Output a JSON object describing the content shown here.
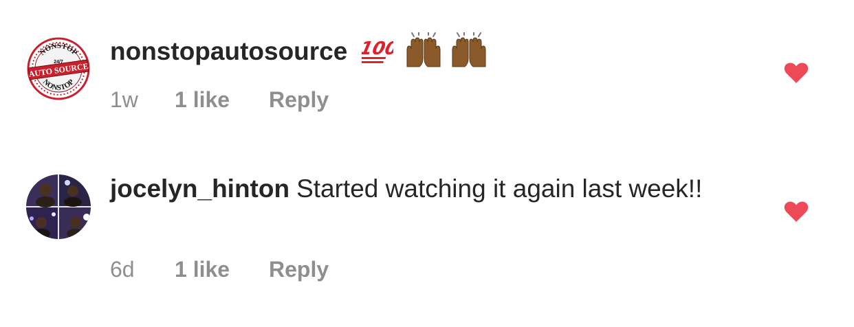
{
  "comments": [
    {
      "avatar_text": {
        "top": "NONSTOP",
        "middle_small": "24/7",
        "banner": "AUTO SOURCE",
        "bottom": "NONSTOP"
      },
      "username": "nonstopautosource",
      "text": "",
      "emojis": [
        "hundred-points",
        "raising-hands",
        "raising-hands"
      ],
      "time": "1w",
      "likes": "1 like",
      "reply": "Reply",
      "liked": true
    },
    {
      "username": "jocelyn_hinton",
      "text": "Started watching it again last week!!",
      "time": "6d",
      "likes": "1 like",
      "reply": "Reply",
      "liked": true
    }
  ],
  "colors": {
    "heart": "#ed4956",
    "username": "#262626",
    "meta": "#8e8e8e",
    "logo_red": "#c8202c"
  }
}
